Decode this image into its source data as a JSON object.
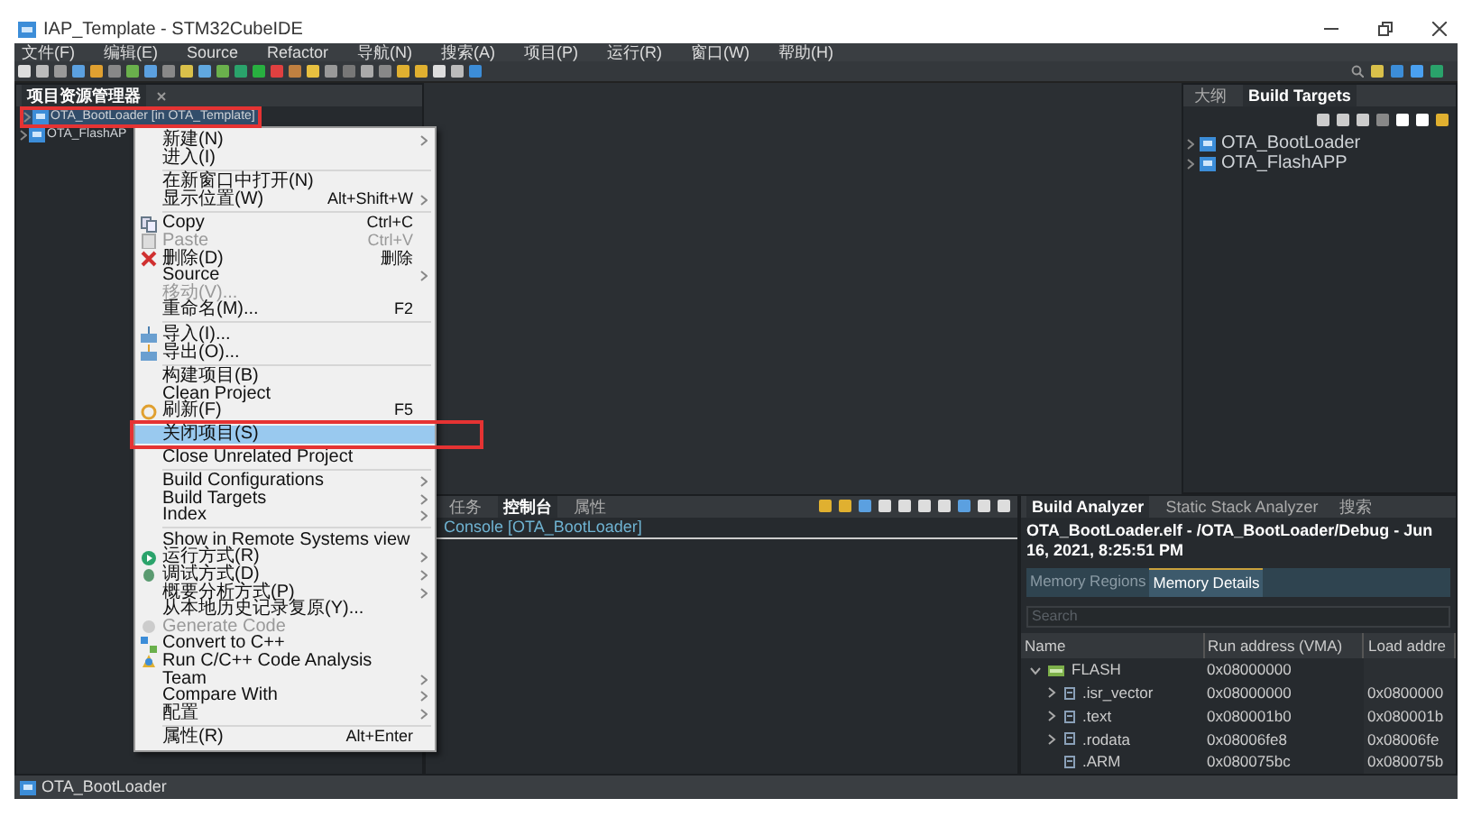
{
  "window": {
    "title": "IAP_Template - STM32CubeIDE"
  },
  "menu_bar": [
    "文件(F)",
    "编辑(E)",
    "Source",
    "Refactor",
    "导航(N)",
    "搜索(A)",
    "项目(P)",
    "运行(R)",
    "窗口(W)",
    "帮助(H)"
  ],
  "project_explorer": {
    "tab": "项目资源管理器",
    "items": [
      {
        "label": "OTA_BootLoader [in OTA_Template]",
        "selected": true,
        "annotated": true
      },
      {
        "label": "OTA_FlashAP",
        "selected": false,
        "annotated": false
      }
    ]
  },
  "context_menu": [
    {
      "kind": "item",
      "label": "新建(N)",
      "submenu": true
    },
    {
      "kind": "item",
      "label": "进入(I)"
    },
    {
      "kind": "separator"
    },
    {
      "kind": "item",
      "label": "在新窗口中打开(N)"
    },
    {
      "kind": "item",
      "label": "显示位置(W)",
      "shortcut": "Alt+Shift+W",
      "submenu": true
    },
    {
      "kind": "separator"
    },
    {
      "kind": "item",
      "label": "Copy",
      "shortcut": "Ctrl+C"
    },
    {
      "kind": "item",
      "label": "Paste",
      "shortcut": "Ctrl+V",
      "disabled": true
    },
    {
      "kind": "item",
      "label": "删除(D)",
      "shortcut": "删除"
    },
    {
      "kind": "item",
      "label": "Source",
      "submenu": true
    },
    {
      "kind": "item",
      "label": "移动(V)...",
      "disabled": true
    },
    {
      "kind": "item",
      "label": "重命名(M)...",
      "shortcut": "F2"
    },
    {
      "kind": "separator"
    },
    {
      "kind": "item",
      "label": "导入(I)..."
    },
    {
      "kind": "item",
      "label": "导出(O)..."
    },
    {
      "kind": "separator"
    },
    {
      "kind": "item",
      "label": "构建项目(B)"
    },
    {
      "kind": "item",
      "label": "Clean Project"
    },
    {
      "kind": "item",
      "label": "刷新(F)",
      "shortcut": "F5"
    },
    {
      "kind": "item",
      "label": "关闭项目(S)",
      "selected": true,
      "annotated": true
    },
    {
      "kind": "item",
      "label": "Close Unrelated Project"
    },
    {
      "kind": "separator"
    },
    {
      "kind": "item",
      "label": "Build Configurations",
      "submenu": true
    },
    {
      "kind": "item",
      "label": "Build Targets",
      "submenu": true
    },
    {
      "kind": "item",
      "label": "Index",
      "submenu": true
    },
    {
      "kind": "separator"
    },
    {
      "kind": "item",
      "label": "Show in Remote Systems view"
    },
    {
      "kind": "item",
      "label": "运行方式(R)",
      "submenu": true
    },
    {
      "kind": "item",
      "label": "调试方式(D)",
      "submenu": true
    },
    {
      "kind": "item",
      "label": "概要分析方式(P)",
      "submenu": true
    },
    {
      "kind": "item",
      "label": "从本地历史记录复原(Y)..."
    },
    {
      "kind": "item",
      "label": "Generate Code",
      "disabled": true
    },
    {
      "kind": "item",
      "label": "Convert to C++"
    },
    {
      "kind": "item",
      "label": "Run C/C++ Code Analysis"
    },
    {
      "kind": "item",
      "label": "Team",
      "submenu": true
    },
    {
      "kind": "item",
      "label": "Compare With",
      "submenu": true
    },
    {
      "kind": "item",
      "label": "配置",
      "submenu": true
    },
    {
      "kind": "separator"
    },
    {
      "kind": "item",
      "label": "属性(R)",
      "shortcut": "Alt+Enter"
    }
  ],
  "outline_panel": {
    "tabs": [
      {
        "label": "大纲",
        "selected": false
      },
      {
        "label": "Build Targets",
        "selected": true
      }
    ],
    "items": [
      "OTA_BootLoader",
      "OTA_FlashAPP"
    ]
  },
  "console_panel": {
    "tabs": [
      {
        "label": "任务",
        "selected": false
      },
      {
        "label": "控制台",
        "selected": true
      },
      {
        "label": "属性",
        "selected": false
      }
    ],
    "console_title": "Console [OTA_BootLoader]"
  },
  "build_analyzer": {
    "tabs": [
      {
        "label": "Build Analyzer",
        "selected": true
      },
      {
        "label": "Static Stack Analyzer",
        "selected": false
      },
      {
        "label": "搜索",
        "selected": false
      }
    ],
    "heading": "OTA_BootLoader.elf - /OTA_BootLoader/Debug - Jun 16, 2021, 8:25:51 PM",
    "subtabs": [
      {
        "label": "Memory Regions",
        "selected": false
      },
      {
        "label": "Memory Details",
        "selected": true
      }
    ],
    "search": {
      "placeholder": "Search"
    },
    "columns": [
      "Name",
      "Run address (VMA)",
      "Load addre"
    ],
    "rows": [
      {
        "name": "FLASH",
        "kind": "region",
        "expanded": true,
        "run": "0x08000000"
      },
      {
        "name": ".isr_vector",
        "kind": "section",
        "expanded": false,
        "run": "0x08000000",
        "load": "0x0800000"
      },
      {
        "name": ".text",
        "kind": "section",
        "expanded": false,
        "run": "0x080001b0",
        "load": "0x080001b"
      },
      {
        "name": ".rodata",
        "kind": "section",
        "expanded": false,
        "run": "0x08006fe8",
        "load": "0x08006fe"
      },
      {
        "name": ".ARM",
        "kind": "leaf",
        "run": "0x080075bc",
        "load": "0x080075b"
      }
    ]
  },
  "status_bar": {
    "text": "OTA_BootLoader"
  }
}
